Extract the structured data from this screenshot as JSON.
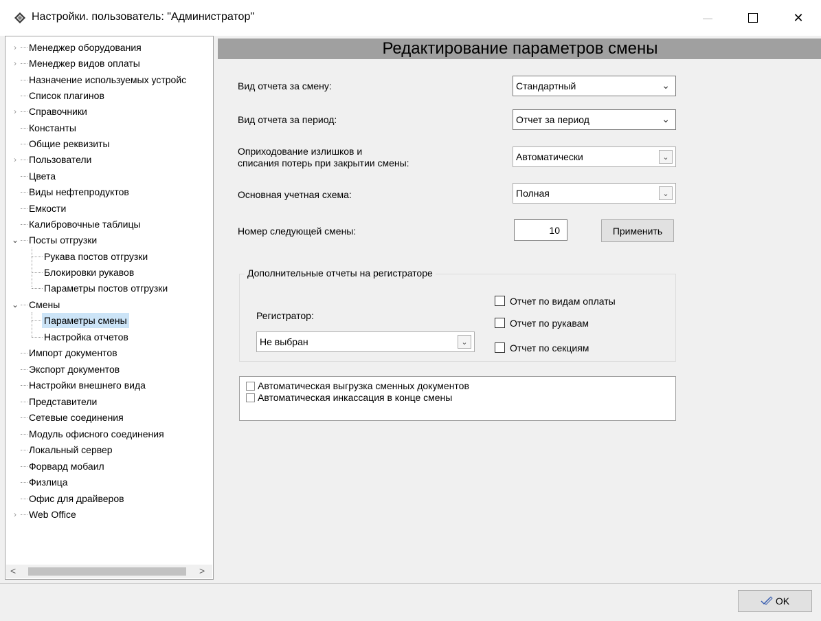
{
  "window": {
    "title": "Настройки. пользователь: \"Администратор\"",
    "icons": {
      "app": "diamond-app-icon",
      "minimize": "minimize-icon",
      "maximize": "maximize-icon",
      "close": "close-icon"
    },
    "min_glyph": "—",
    "max_glyph": "☐",
    "close_glyph": "✕"
  },
  "tree": {
    "items": [
      {
        "label": "Менеджер оборудования"
      },
      {
        "label": "Менеджер видов оплаты"
      },
      {
        "label": "Назначение используемых устройс"
      },
      {
        "label": "Список плагинов"
      },
      {
        "label": "Справочники"
      },
      {
        "label": "Константы"
      },
      {
        "label": "Общие реквизиты"
      },
      {
        "label": "Пользователи"
      },
      {
        "label": "Цвета"
      },
      {
        "label": "Виды нефтепродуктов"
      },
      {
        "label": "Емкости"
      },
      {
        "label": "Калибровочные таблицы"
      },
      {
        "label": "Посты отгрузки"
      },
      {
        "label": "Рукава постов отгрузки"
      },
      {
        "label": "Блокировки рукавов"
      },
      {
        "label": "Параметры постов отгрузки"
      },
      {
        "label": "Смены"
      },
      {
        "label": "Параметры смены"
      },
      {
        "label": "Настройка отчетов"
      },
      {
        "label": "Импорт документов"
      },
      {
        "label": "Экспорт документов"
      },
      {
        "label": "Настройки внешнего вида"
      },
      {
        "label": "Представители"
      },
      {
        "label": "Сетевые соединения"
      },
      {
        "label": "Модуль офисного соединения"
      },
      {
        "label": "Локальный сервер"
      },
      {
        "label": "Форвард мобаил"
      },
      {
        "label": "Физлица"
      },
      {
        "label": "Офис для драйверов"
      },
      {
        "label": "Web Office"
      }
    ],
    "selected": "Параметры смены",
    "collapsed_glyph": "›",
    "expanded_glyph": "⌄",
    "scroll_left_glyph": "<",
    "scroll_right_glyph": ">"
  },
  "main": {
    "header": "Редактирование параметров смены",
    "shift_report_label": "Вид отчета за смену:",
    "shift_report_value": "Стандартный",
    "period_report_label": "Вид отчета за период:",
    "period_report_value": "Отчет за период",
    "surplus_label_1": "Оприходование излишков и",
    "surplus_label_2": "списания потерь при закрытии смены:",
    "surplus_value": "Автоматически",
    "scheme_label": "Основная учетная схема:",
    "scheme_value": "Полная",
    "next_shift_label": "Номер следующей смены:",
    "next_shift_value": "10",
    "apply_label": "Применить",
    "dropdown_glyph": "⌄",
    "group": {
      "title": "Дополнительные отчеты на регистраторе",
      "registrar_label": "Регистратор:",
      "registrar_value": "Не выбран",
      "cb_payment": "Отчет по видам оплаты",
      "cb_hoses": "Отчет по рукавам",
      "cb_sections": "Отчет по секциям"
    },
    "auto_upload": "Автоматическая выгрузка сменных документов",
    "auto_collection": "Автоматическая инкассация в конце смены"
  },
  "footer": {
    "ok_label": "OK",
    "ok_icon": "checkmark-pencil-icon"
  }
}
